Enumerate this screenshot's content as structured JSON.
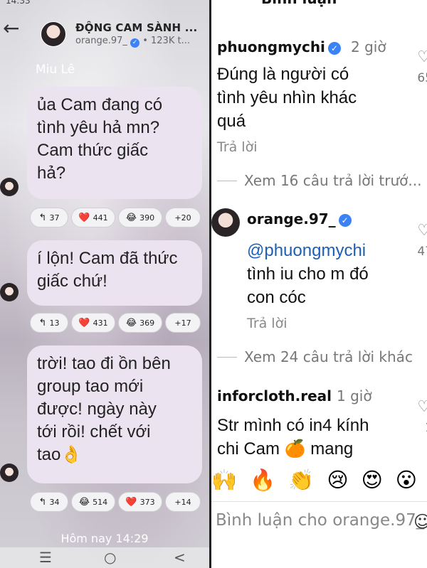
{
  "left": {
    "status_time": "14:33",
    "header": {
      "title": "ĐỘNG CAM SÀNH ...",
      "username": "orange.97_",
      "members": "• 123K t..."
    },
    "sender": "Miu Lê",
    "messages": [
      {
        "text_lines": [
          "ủa Cam đang có",
          "tình yêu hả mn?",
          "Cam thức giấc",
          "hả?"
        ],
        "reactions": {
          "reply": "37",
          "heart": "441",
          "laugh": "390",
          "more": "+20"
        }
      },
      {
        "text_lines": [
          "í lộn! Cam đã thức",
          "giấc chứ!"
        ],
        "reactions": {
          "reply": "13",
          "heart": "431",
          "laugh": "369",
          "more": "+17"
        }
      },
      {
        "text_lines": [
          "trời! tao đi ồn bên",
          "group tao mới",
          "được! ngày này",
          "tới rồi! chết với",
          "tao👌"
        ],
        "reactions": {
          "reply": "34",
          "laugh": "514",
          "heart": "373",
          "more": "+14"
        }
      }
    ],
    "bottom_time": "Hôm nay 14:29"
  },
  "right": {
    "title": "Bình luận",
    "comments": [
      {
        "username": "phuongmychi",
        "time": "2 giờ",
        "text_lines": [
          "Đúng là người có",
          "tình yêu nhìn khác",
          "quá"
        ],
        "reply_label": "Trả lời",
        "like_count": "65"
      },
      {
        "username": "orange.97_",
        "time": "",
        "mention": "@phuongmychi",
        "text_lines": [
          "tình iu cho m đó",
          "con cóc"
        ],
        "reply_label": "Trả lời",
        "like_count": "47"
      },
      {
        "username": "inforcloth.real",
        "time": "1 giờ",
        "text_lines": [
          "Str mình có in4 kính",
          "chi Cam 🍊 mang"
        ],
        "like_count": "1"
      }
    ],
    "view_more": [
      "Xem 16 câu trả lời trướ...",
      "Xem 24 câu trả lời khác"
    ],
    "emoji_bar": [
      "🙌",
      "🔥",
      "👏",
      "😢",
      "😍",
      "😮",
      "😂"
    ],
    "input_placeholder": "Bình luận cho orange.97_..."
  },
  "colors": {
    "bubble": "#ebe3ef",
    "verified": "#3b82f6",
    "mention": "#1d5fb4"
  }
}
